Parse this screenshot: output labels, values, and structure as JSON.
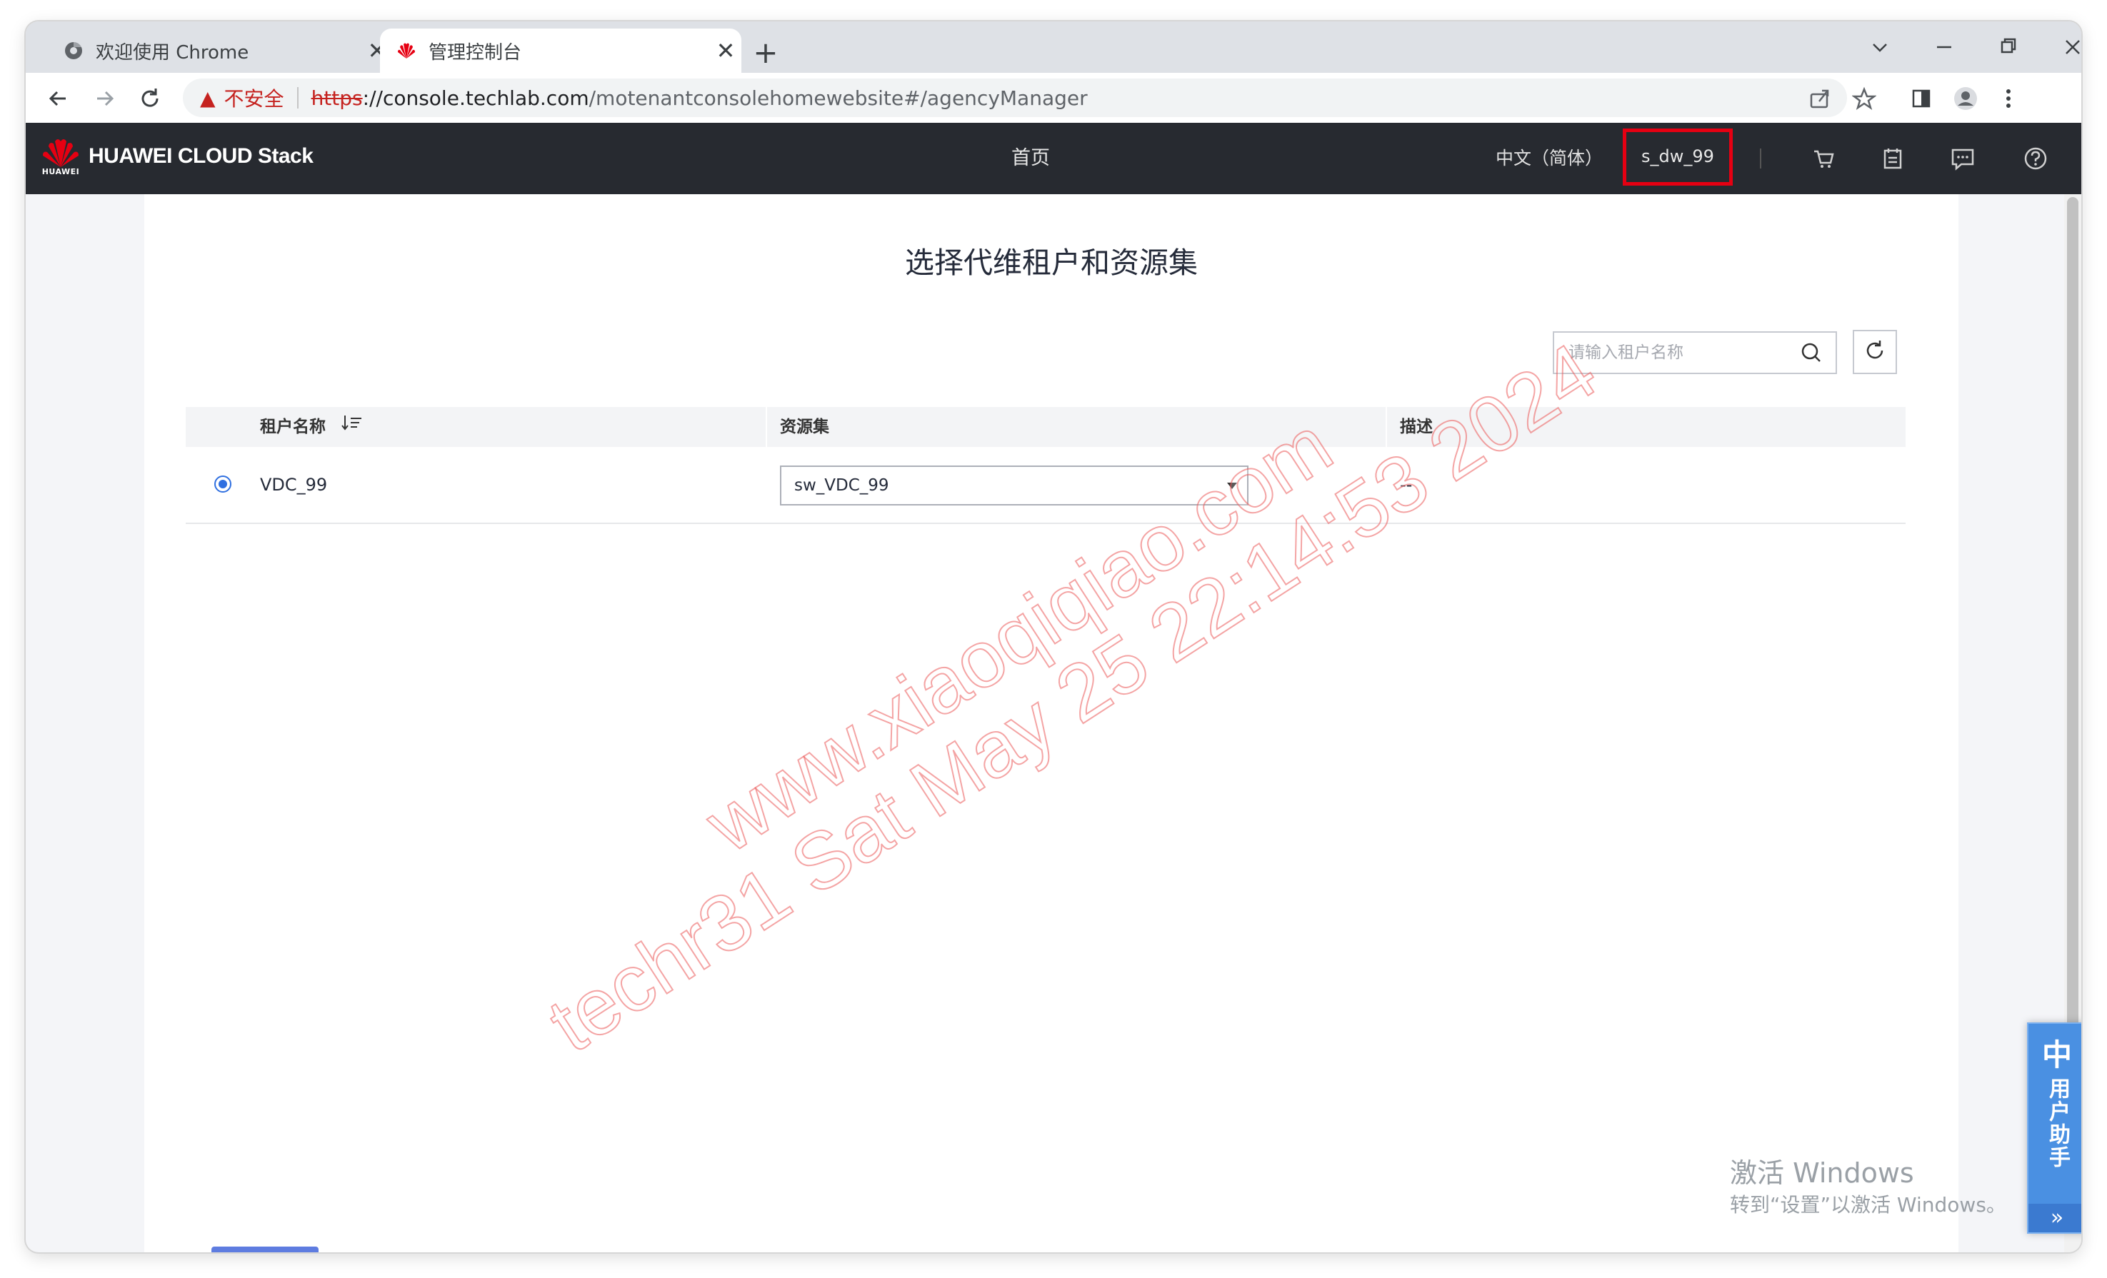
{
  "browser": {
    "tabs": [
      {
        "label": "欢迎使用 Chrome",
        "close": "✕"
      },
      {
        "label": "管理控制台",
        "close": "✕"
      }
    ],
    "new_tab": "+",
    "controls": {
      "dropdown": "⌄",
      "minimize": "—",
      "restore": "❐",
      "close": "✕"
    },
    "address": {
      "security_label": "不安全",
      "scheme": "https",
      "host_rest": "://console.techlab.com",
      "path": "/motenantconsolehomewebsite#/agencyManager"
    }
  },
  "app": {
    "brand_small": "HUAWEI",
    "brand": "HUAWEI CLOUD Stack",
    "nav_home": "首页",
    "language": "中文（简体）",
    "user": "s_dw_99",
    "icons": [
      "cart-icon",
      "calendar-icon",
      "message-icon",
      "help-icon"
    ]
  },
  "page": {
    "title": "选择代维租户和资源集",
    "search_placeholder": "请输入租户名称",
    "table": {
      "columns": [
        "租户名称",
        "资源集",
        "描述"
      ],
      "rows": [
        {
          "name": "VDC_99",
          "resource_set": "sw_VDC_99",
          "description": "--",
          "selected": true
        }
      ]
    }
  },
  "watermark": {
    "line1": "www.xiaoqiqiao.com",
    "line2": "techr31 Sat May 25 22:14:53 2024"
  },
  "activation": {
    "title": "激活 Windows",
    "subtitle": "转到“设置”以激活 Windows。"
  },
  "helper": {
    "top": "中",
    "label": "用户助手",
    "chevron": "»"
  },
  "colors": {
    "header_bg": "#272a30",
    "highlight_border": "#e60012",
    "radio_accent": "#2f6fe0",
    "helper_bg": "#4a90e2"
  }
}
